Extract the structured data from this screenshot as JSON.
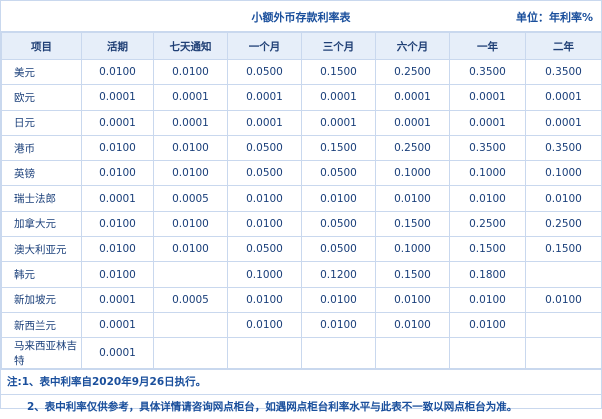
{
  "header": {
    "title": "小额外币存款利率表",
    "unit": "单位：年利率%"
  },
  "table": {
    "columns": [
      "项目",
      "活期",
      "七天通知",
      "一个月",
      "三个月",
      "六个月",
      "一年",
      "二年"
    ],
    "rows": [
      {
        "name": "美元",
        "values": [
          "0.0100",
          "0.0100",
          "0.0500",
          "0.1500",
          "0.2500",
          "0.3500",
          "0.3500"
        ]
      },
      {
        "name": "欧元",
        "values": [
          "0.0001",
          "0.0001",
          "0.0001",
          "0.0001",
          "0.0001",
          "0.0001",
          "0.0001"
        ]
      },
      {
        "name": "日元",
        "values": [
          "0.0001",
          "0.0001",
          "0.0001",
          "0.0001",
          "0.0001",
          "0.0001",
          "0.0001"
        ]
      },
      {
        "name": "港币",
        "values": [
          "0.0100",
          "0.0100",
          "0.0500",
          "0.1500",
          "0.2500",
          "0.3500",
          "0.3500"
        ]
      },
      {
        "name": "英镑",
        "values": [
          "0.0100",
          "0.0100",
          "0.0500",
          "0.0500",
          "0.1000",
          "0.1000",
          "0.1000"
        ]
      },
      {
        "name": "瑞士法郎",
        "values": [
          "0.0001",
          "0.0005",
          "0.0100",
          "0.0100",
          "0.0100",
          "0.0100",
          "0.0100"
        ]
      },
      {
        "name": "加拿大元",
        "values": [
          "0.0100",
          "0.0100",
          "0.0100",
          "0.0500",
          "0.1500",
          "0.2500",
          "0.2500"
        ]
      },
      {
        "name": "澳大利亚元",
        "values": [
          "0.0100",
          "0.0100",
          "0.0500",
          "0.0500",
          "0.1000",
          "0.1500",
          "0.1500"
        ]
      },
      {
        "name": "韩元",
        "values": [
          "0.0100",
          "",
          "0.1000",
          "0.1200",
          "0.1500",
          "0.1800",
          ""
        ]
      },
      {
        "name": "新加坡元",
        "values": [
          "0.0001",
          "0.0005",
          "0.0100",
          "0.0100",
          "0.0100",
          "0.0100",
          "0.0100"
        ]
      },
      {
        "name": "新西兰元",
        "values": [
          "0.0001",
          "",
          "0.0100",
          "0.0100",
          "0.0100",
          "0.0100",
          ""
        ]
      },
      {
        "name": "马来西亚林吉特",
        "values": [
          "0.0001",
          "",
          "",
          "",
          "",
          "",
          ""
        ]
      }
    ]
  },
  "notes": [
    "注:1、表中利率自2020年9月26日执行。",
    "2、表中利率仅供参考，具体详情请咨询网点柜台，如遇网点柜台利率水平与此表不一致以网点柜台为准。"
  ]
}
